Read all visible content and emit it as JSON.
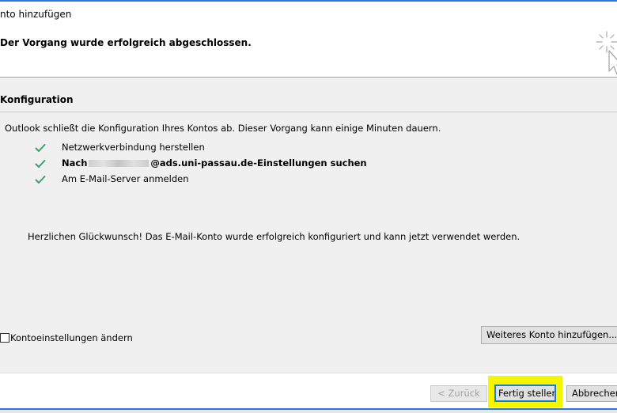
{
  "window": {
    "title": "nto hinzufügen",
    "accent_color": "#2b79d6"
  },
  "status": {
    "subtitle": "Der Vorgang wurde erfolgreich abgeschlossen.",
    "spinner_icon": "busy-spinner-icon"
  },
  "configuration": {
    "section_title": "Konfiguration",
    "intro": "Outlook schließt die Konfiguration Ihres Kontos ab. Dieser Vorgang kann einige Minuten dauern.",
    "steps": [
      {
        "icon": "checkmark-icon",
        "text": "Netzwerkverbindung herstellen",
        "bold": false
      },
      {
        "icon": "checkmark-icon",
        "prefix": "Nach",
        "suffix": "@ads.uni-passau.de-Einstellungen suchen",
        "bold": true,
        "redacted": true
      },
      {
        "icon": "checkmark-icon",
        "text": "Am E-Mail-Server anmelden",
        "bold": false
      }
    ],
    "check_color": "#3c9e6e",
    "congrats": "Herzlichen Glückwunsch! Das E-Mail-Konto wurde erfolgreich konfiguriert und kann jetzt verwendet werden."
  },
  "options": {
    "change_settings_label": "Kontoeinstellungen ändern",
    "change_settings_checked": false,
    "add_account_label": "Weiteres Konto hinzufügen..."
  },
  "footer": {
    "back_label": "< Zurück",
    "back_enabled": false,
    "finish_label": "Fertig stellen",
    "cancel_label": "Abbrechen",
    "highlight_color": "#f5f500"
  }
}
